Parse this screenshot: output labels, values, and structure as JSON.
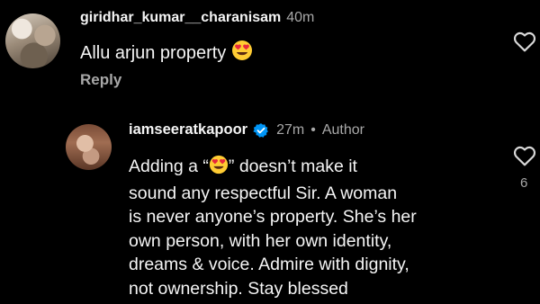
{
  "comments": [
    {
      "username": "giridhar_kumar__charanisam",
      "time": "40m",
      "text": "Allu arjun property",
      "emoji": "heart-eyes-emoji",
      "reply_label": "Reply"
    },
    {
      "username": "iamseeratkapoor",
      "time": "27m",
      "separator": "•",
      "badge": "Author",
      "text_prefix": "Adding a “",
      "text_suffix": "” doesn’t make it",
      "text_lines": [
        "sound any respectful Sir. A woman",
        "is never anyone’s property. She’s her",
        "own person, with her own identity,",
        "dreams & voice. Admire with dignity,",
        "not ownership. Stay blessed"
      ],
      "likes": "6"
    }
  ],
  "colors": {
    "background": "#000000",
    "text": "#f5f5f5",
    "muted": "#a8a8a8",
    "verified": "#0095f6"
  }
}
